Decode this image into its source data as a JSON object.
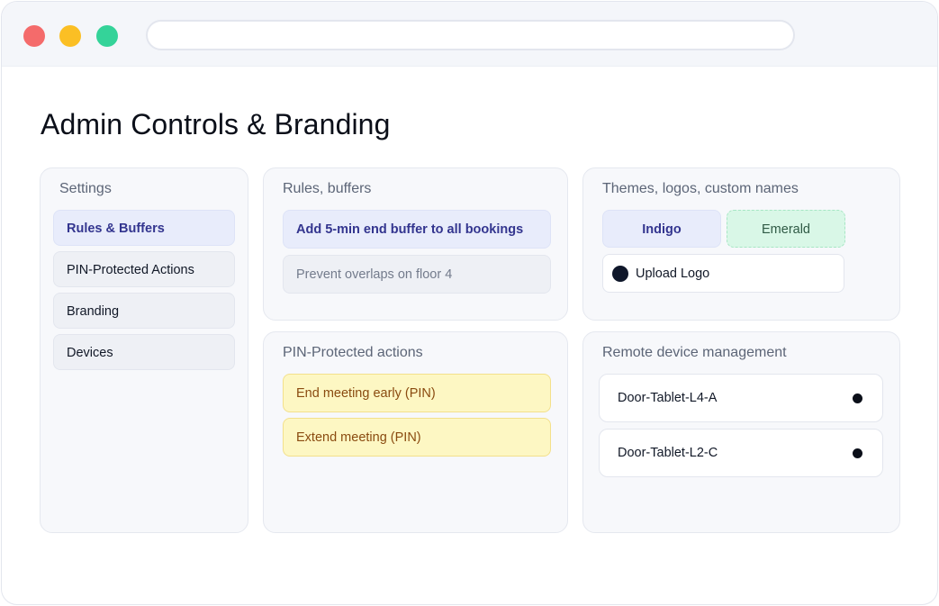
{
  "page": {
    "title": "Admin Controls & Branding"
  },
  "settings": {
    "title": "Settings",
    "items": [
      {
        "label": "Rules & Buffers",
        "active": true
      },
      {
        "label": "PIN-Protected Actions",
        "active": false
      },
      {
        "label": "Branding",
        "active": false
      },
      {
        "label": "Devices",
        "active": false
      }
    ]
  },
  "rules": {
    "title": "Rules, buffers",
    "items": [
      {
        "label": "Add 5-min end buffer to all bookings"
      },
      {
        "label": "Prevent overlaps on floor 4"
      }
    ]
  },
  "pin": {
    "title": "PIN-Protected actions",
    "items": [
      {
        "label": "End meeting early (PIN)"
      },
      {
        "label": "Extend meeting (PIN)"
      }
    ]
  },
  "branding": {
    "title": "Themes, logos, custom names",
    "themes": [
      {
        "label": "Indigo",
        "color": "#e8ecfb"
      },
      {
        "label": "Emerald",
        "color": "#d9f7e7"
      }
    ],
    "upload_label": "Upload Logo"
  },
  "devices": {
    "title": "Remote device management",
    "items": [
      {
        "name": "Door-Tablet-L4-A"
      },
      {
        "name": "Door-Tablet-L2-C"
      }
    ]
  }
}
